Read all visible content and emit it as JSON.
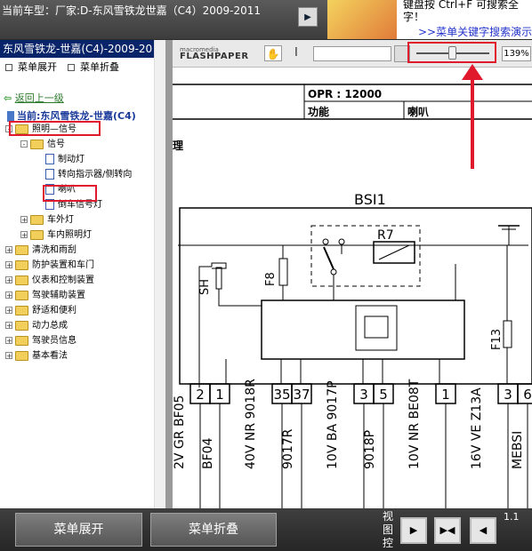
{
  "top": {
    "title": "当前车型：厂家:D-东风雪铁龙世嘉（C4）2009-2011",
    "ad_line1": "键盘按  Ctrl+F  可搜索全",
    "ad_line2": "字！",
    "ad_link": ">>菜单关键字搜索演示"
  },
  "sidebar": {
    "title": "东风雪铁龙-世嘉(C4)-2009-20",
    "expand_all": "菜单展开",
    "collapse_all": "菜单折叠",
    "back": "返回上一级",
    "current": "当前:东风雪铁龙-世嘉(C4)",
    "tree": [
      {
        "label": "照明—信号",
        "level": 0,
        "type": "folder",
        "state": "-"
      },
      {
        "label": "信号",
        "level": 1,
        "type": "folder",
        "state": "-"
      },
      {
        "label": "制动灯",
        "level": 2,
        "type": "page"
      },
      {
        "label": "转向指示器/侧转向",
        "level": 2,
        "type": "page"
      },
      {
        "label": "喇叭",
        "level": 2,
        "type": "page"
      },
      {
        "label": "倒车信号灯",
        "level": 2,
        "type": "page"
      },
      {
        "label": "车外灯",
        "level": 1,
        "type": "folder",
        "state": "+"
      },
      {
        "label": "车内照明灯",
        "level": 1,
        "type": "folder",
        "state": "+"
      },
      {
        "label": "清洗和雨刮",
        "level": 0,
        "type": "folder",
        "state": "+"
      },
      {
        "label": "防护装置和车门",
        "level": 0,
        "type": "folder",
        "state": "+"
      },
      {
        "label": "仪表和控制装置",
        "level": 0,
        "type": "folder",
        "state": "+"
      },
      {
        "label": "驾驶辅助装置",
        "level": 0,
        "type": "folder",
        "state": "+"
      },
      {
        "label": "舒适和便利",
        "level": 0,
        "type": "folder",
        "state": "+"
      },
      {
        "label": "动力总成",
        "level": 0,
        "type": "folder",
        "state": "+"
      },
      {
        "label": "驾驶员信息",
        "level": 0,
        "type": "folder",
        "state": "+"
      },
      {
        "label": "基本看法",
        "level": 0,
        "type": "folder",
        "state": "+"
      }
    ]
  },
  "viewer": {
    "logo_small": "macromedia",
    "logo_big": "FLASHPAPER",
    "zoom": "139%",
    "zoom_fraction": 0.5,
    "doc": {
      "opr": "OPR : 12000",
      "func_label": "功能",
      "func_value": "喇叭",
      "section": "理",
      "bsi": "BSI1",
      "r7": "R7",
      "f8": "F8",
      "f13": "F13",
      "sh": "SH",
      "pins": [
        "2",
        "1",
        "35",
        "37",
        "3",
        "5",
        "1",
        "3",
        "6"
      ],
      "wires": [
        "2V  GR  BF05",
        "BF04",
        "40V  NR  9018R",
        "9017R",
        "10V  BA  9017P",
        "9018P",
        "10V  NR  BE08T",
        "16V  VE  Z13A",
        "MEBSI"
      ]
    }
  },
  "bottom": {
    "expand": "菜单展开",
    "collapse": "菜单折叠",
    "view_label": "视图控",
    "page": "1.1"
  }
}
